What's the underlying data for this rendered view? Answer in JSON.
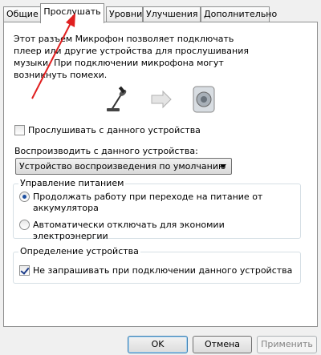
{
  "tabs": [
    {
      "label": "Общие"
    },
    {
      "label": "Прослушать"
    },
    {
      "label": "Уровни"
    },
    {
      "label": "Улучшения"
    },
    {
      "label": "Дополнительно"
    }
  ],
  "description": "Этот разъем Микрофон позволяет подключать плеер или другие устройства для прослушивания музыки. При подключении микрофона могут возникнуть помехи.",
  "listen_checkbox": {
    "label": "Прослушивать с данного устройства",
    "checked": false
  },
  "playback": {
    "label": "Воспроизводить с данного устройства:",
    "selected": "Устройство воспроизведения по умолчанию"
  },
  "power_group": {
    "title": "Управление питанием",
    "options": [
      {
        "label_line1": "Продолжать работу при переходе на питание от",
        "label_line2": "аккумулятора",
        "checked": true
      },
      {
        "label": "Автоматически отключать для экономии электроэнергии",
        "checked": false
      }
    ]
  },
  "detect_group": {
    "title": "Определение устройства",
    "checkbox": {
      "label": "Не запрашивать при подключении данного устройства",
      "checked": true
    }
  },
  "buttons": {
    "ok": "OK",
    "cancel": "Отмена",
    "apply": "Применить"
  },
  "colors": {
    "annotation_arrow": "#e02020",
    "accent": "#1d4fa0"
  },
  "icons": [
    "microphone-icon",
    "arrow-right-icon",
    "speaker-icon"
  ]
}
